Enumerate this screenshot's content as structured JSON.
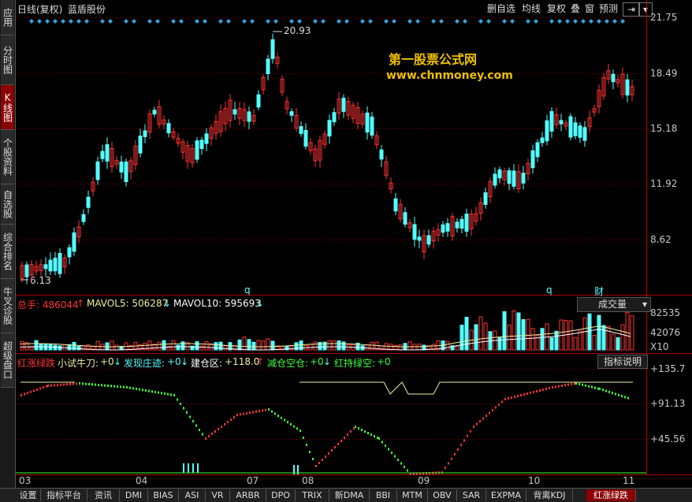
{
  "sidebar": {
    "items": [
      {
        "label": "应用"
      },
      {
        "label": "分时图"
      },
      {
        "label": "K线图"
      },
      {
        "label": "个股资料"
      },
      {
        "label": "自选股"
      },
      {
        "label": "综合排名"
      },
      {
        "label": "牛叉诊股"
      },
      {
        "label": "超级盘口"
      }
    ]
  },
  "header": {
    "period": "日线(复权)",
    "stock_name": "蓝盾股份",
    "buttons": [
      "删自选",
      "均线",
      "复权",
      "叠",
      "窗",
      "预测"
    ]
  },
  "watermark": {
    "line1": "第一股票公式网",
    "line2": "www.chnmoney.com"
  },
  "price_panel": {
    "y_ticks": [
      "21.75",
      "18.49",
      "15.18",
      "11.92",
      "8.62"
    ],
    "high_label": "20.93",
    "low_label": "6.13",
    "markers": [
      "q",
      "q",
      "财"
    ]
  },
  "volume_panel": {
    "total": "总手: 486044",
    "ma5": "MAVOL5: 506287",
    "ma10": "MAVOL10: 595693",
    "combo": "成交量",
    "y_ticks": [
      "82535",
      "42076",
      "X10"
    ]
  },
  "indicator_panel": {
    "name": "红涨绿跌",
    "items": [
      {
        "label": "小试牛刀:",
        "value": "+0"
      },
      {
        "label": "发现庄迹:",
        "value": "+0"
      },
      {
        "label": "建仓区:",
        "value": "+118.0"
      },
      {
        "label": "减仓空仓:",
        "value": "+0"
      },
      {
        "label": "红持绿空:",
        "value": "+0"
      }
    ],
    "help_button": "指标说明",
    "y_ticks": [
      "+135.7",
      "+91.13",
      "+45.56"
    ]
  },
  "x_axis": [
    "03",
    "04",
    "07",
    "08",
    "09",
    "10",
    "11"
  ],
  "bottom_tabs": [
    "设置",
    "指标平台",
    "资讯",
    "DMI",
    "BIAS",
    "ASI",
    "VR",
    "ARBR",
    "DPO",
    "TRIX",
    "新DMA",
    "BBI",
    "MTM",
    "OBV",
    "SAR",
    "EXPMA",
    "背离KDJ",
    "红涨绿跌"
  ],
  "colors": {
    "up": "#ff3232",
    "down": "#54ffff",
    "axis": "#b00000",
    "accent": "#f0c000"
  }
}
